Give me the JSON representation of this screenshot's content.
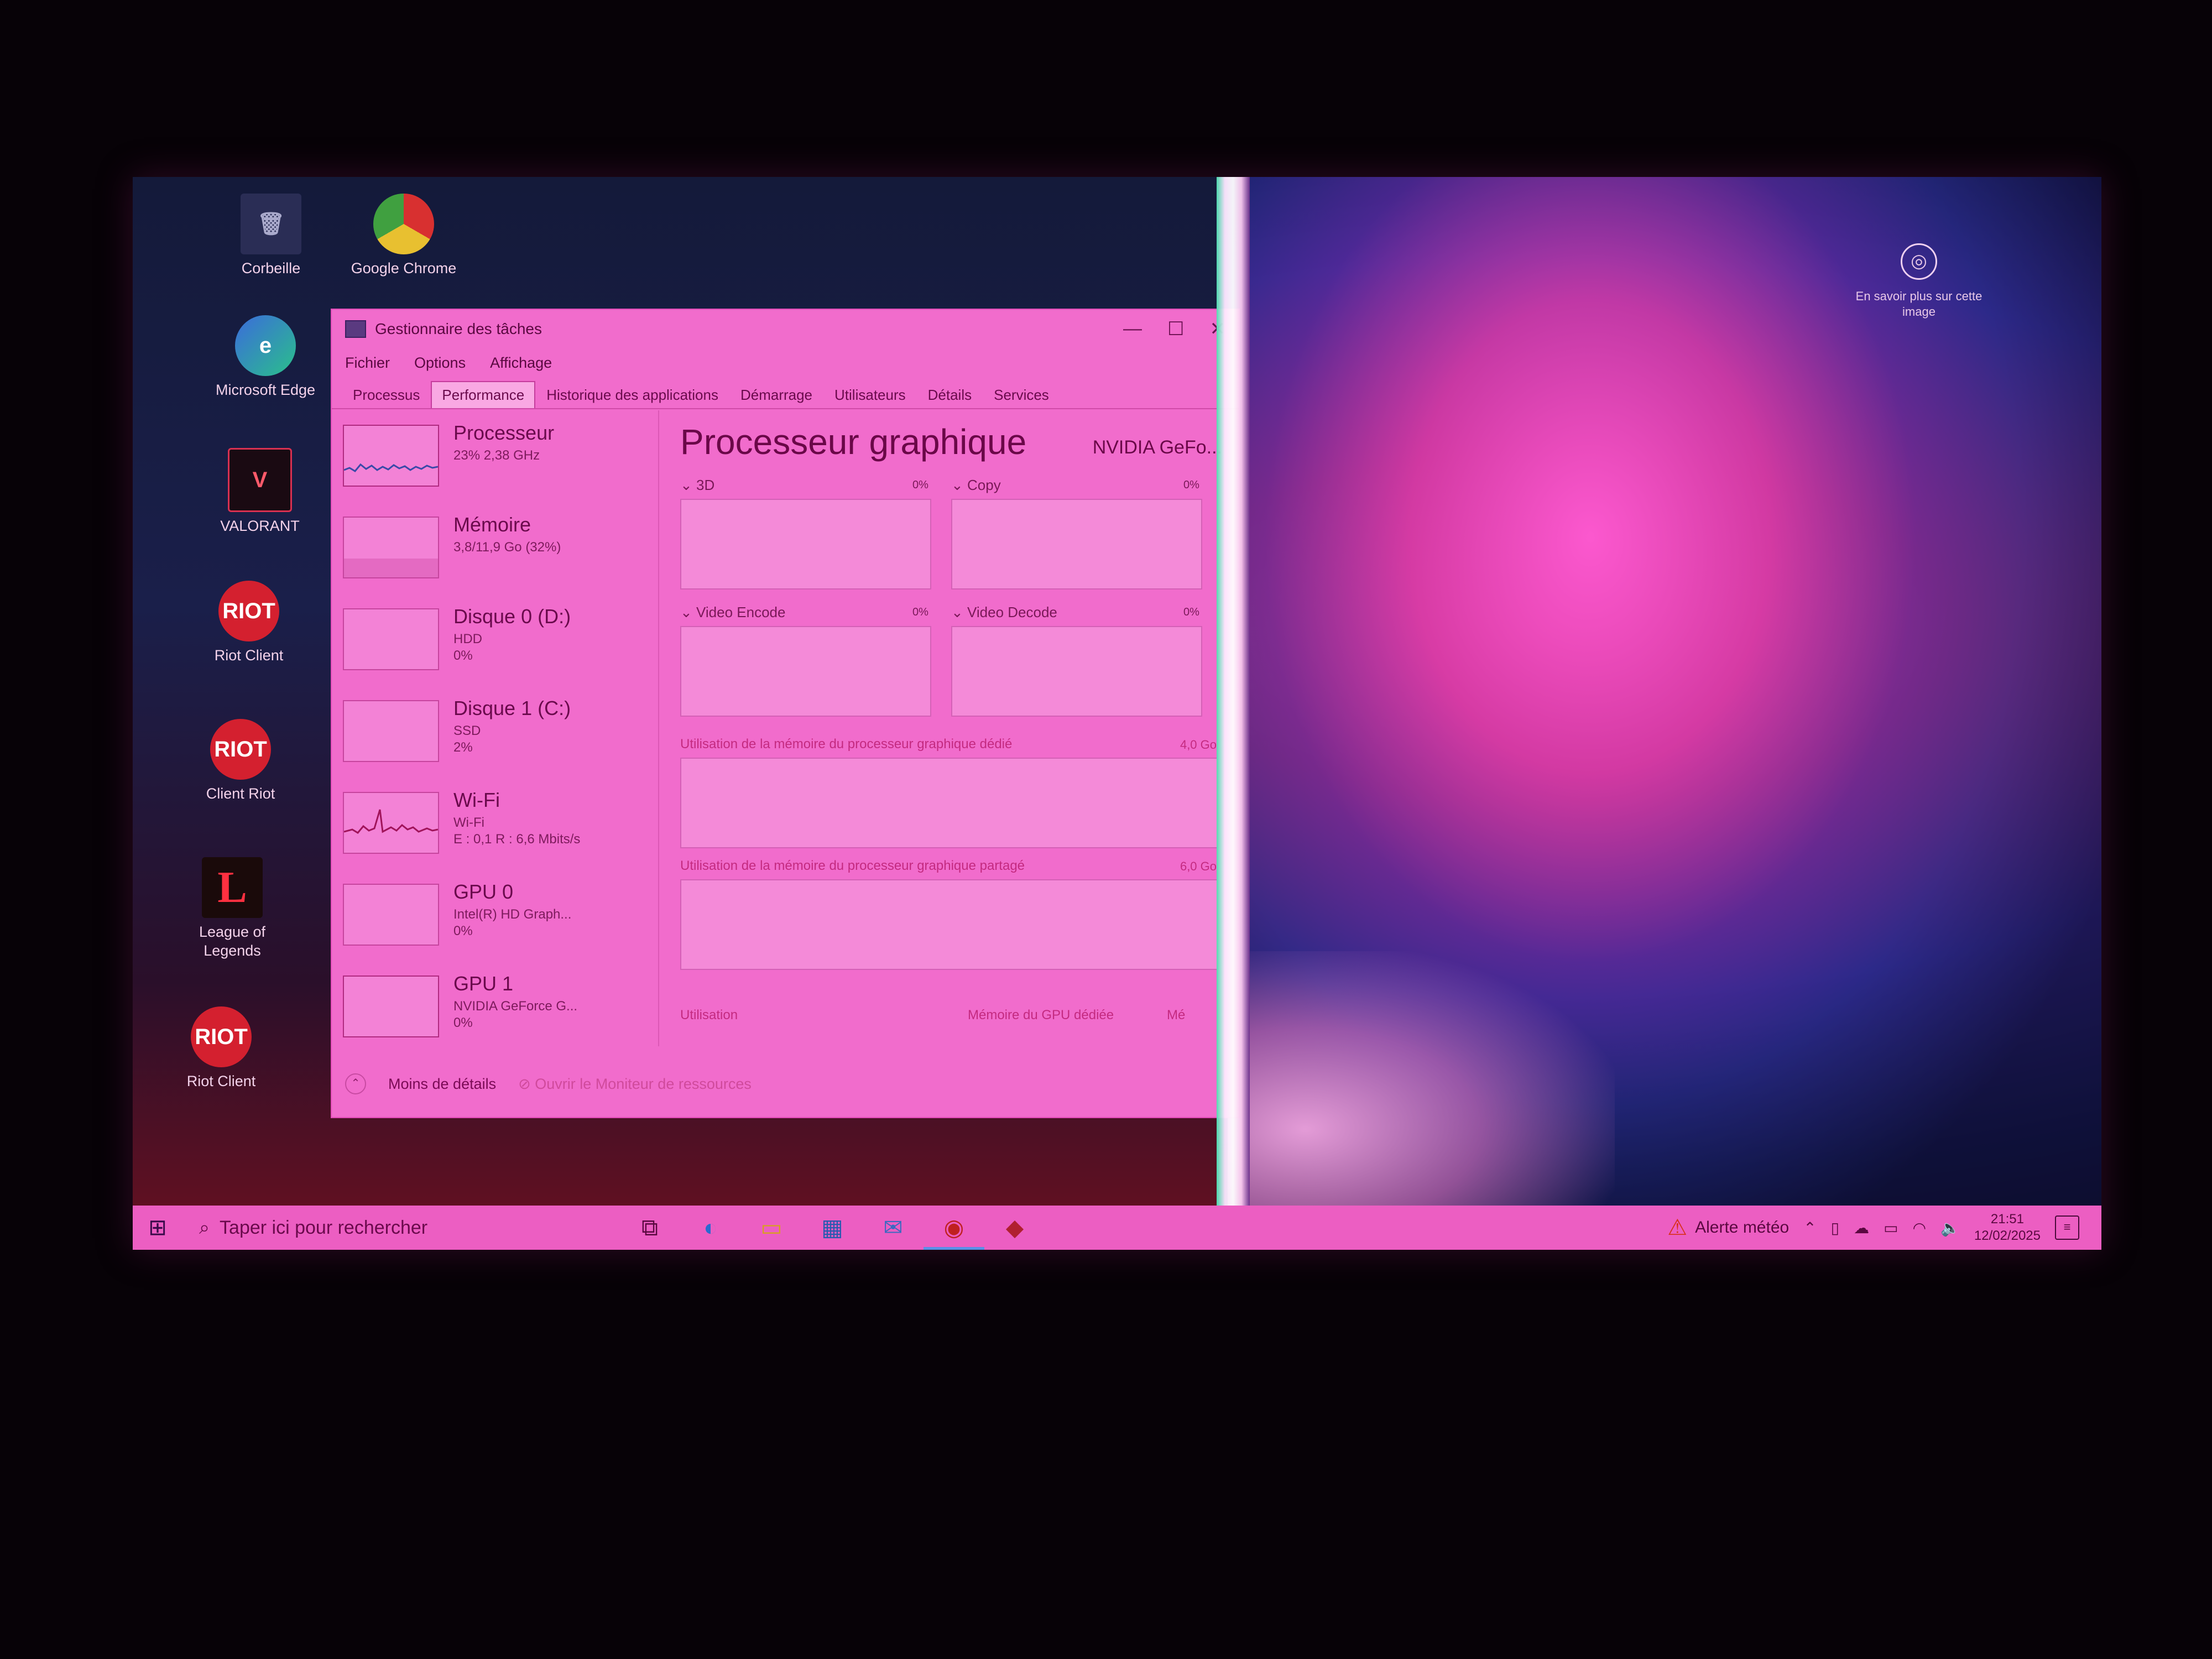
{
  "desktop": {
    "icons": [
      {
        "name": "icon-recycle-bin",
        "label": "Corbeille",
        "glyph": "🗑",
        "style": "trash"
      },
      {
        "name": "icon-google-chrome",
        "label": "Google Chrome",
        "glyph": "",
        "style": "chrome"
      },
      {
        "name": "icon-microsoft-edge",
        "label": "Microsoft Edge",
        "glyph": "e",
        "style": "edge"
      },
      {
        "name": "icon-valorant",
        "label": "VALORANT",
        "glyph": "V",
        "style": "square"
      },
      {
        "name": "icon-riot-client-1",
        "label": "Riot Client",
        "glyph": "RIOT",
        "style": "riot"
      },
      {
        "name": "icon-client-riot",
        "label": "Client Riot",
        "glyph": "RIOT",
        "style": "riot"
      },
      {
        "name": "icon-league-of-legends",
        "label": "League of Legends",
        "glyph": "L",
        "style": "lol"
      },
      {
        "name": "icon-riot-client-2",
        "label": "Riot Client",
        "glyph": "RIOT",
        "style": "riot"
      }
    ],
    "spotlight_text": "En savoir plus sur cette image"
  },
  "taskmgr": {
    "title": "Gestionnaire des tâches",
    "menu": [
      "Fichier",
      "Options",
      "Affichage"
    ],
    "tabs": [
      "Processus",
      "Performance",
      "Historique des applications",
      "Démarrage",
      "Utilisateurs",
      "Détails",
      "Services"
    ],
    "active_tab": "Performance",
    "resources": [
      {
        "name": "Processeur",
        "sub1": "23% 2,38 GHz",
        "sub2": ""
      },
      {
        "name": "Mémoire",
        "sub1": "3,8/11,9 Go (32%)",
        "sub2": ""
      },
      {
        "name": "Disque 0 (D:)",
        "sub1": "HDD",
        "sub2": "0%"
      },
      {
        "name": "Disque 1 (C:)",
        "sub1": "SSD",
        "sub2": "2%"
      },
      {
        "name": "Wi-Fi",
        "sub1": "Wi-Fi",
        "sub2": "E : 0,1 R : 6,6 Mbits/s"
      },
      {
        "name": "GPU 0",
        "sub1": "Intel(R) HD Graph...",
        "sub2": "0%"
      },
      {
        "name": "GPU 1",
        "sub1": "NVIDIA GeForce G...",
        "sub2": "0%"
      }
    ],
    "detail": {
      "title": "Processeur graphique",
      "model": "NVIDIA GeFo...",
      "engines": [
        {
          "label": "3D",
          "pct": "0%"
        },
        {
          "label": "Copy",
          "pct": "0%"
        },
        {
          "label": "Video Encode",
          "pct": "0%"
        },
        {
          "label": "Video Decode",
          "pct": "0%"
        }
      ],
      "dedicated_mem_label": "Utilisation de la mémoire du processeur graphique dédié",
      "dedicated_mem_value": "4,0 Go",
      "shared_mem_label": "Utilisation de la mémoire du processeur graphique partagé",
      "shared_mem_value": "6,0 Go",
      "footer_utilisation": "Utilisation",
      "footer_dedicated": "Mémoire du GPU dédiée",
      "footer_trunc": "Mé"
    },
    "footer": {
      "less_details": "Moins de détails",
      "resource_monitor": "Ouvrir le Moniteur de ressources"
    }
  },
  "taskbar": {
    "search_placeholder": "Taper ici pour rechercher",
    "weather_alert": "Alerte météo",
    "time": "21:51",
    "date": "12/02/2025",
    "apps": [
      "task-view-icon",
      "edge-icon",
      "file-explorer-icon",
      "store-icon",
      "mail-icon",
      "chrome-icon",
      "riot-icon"
    ]
  },
  "colors": {
    "taskmgr_bg": "#f16ccc",
    "taskbar_bg": "#ec5ec2",
    "accent_riot": "#d4202f"
  }
}
